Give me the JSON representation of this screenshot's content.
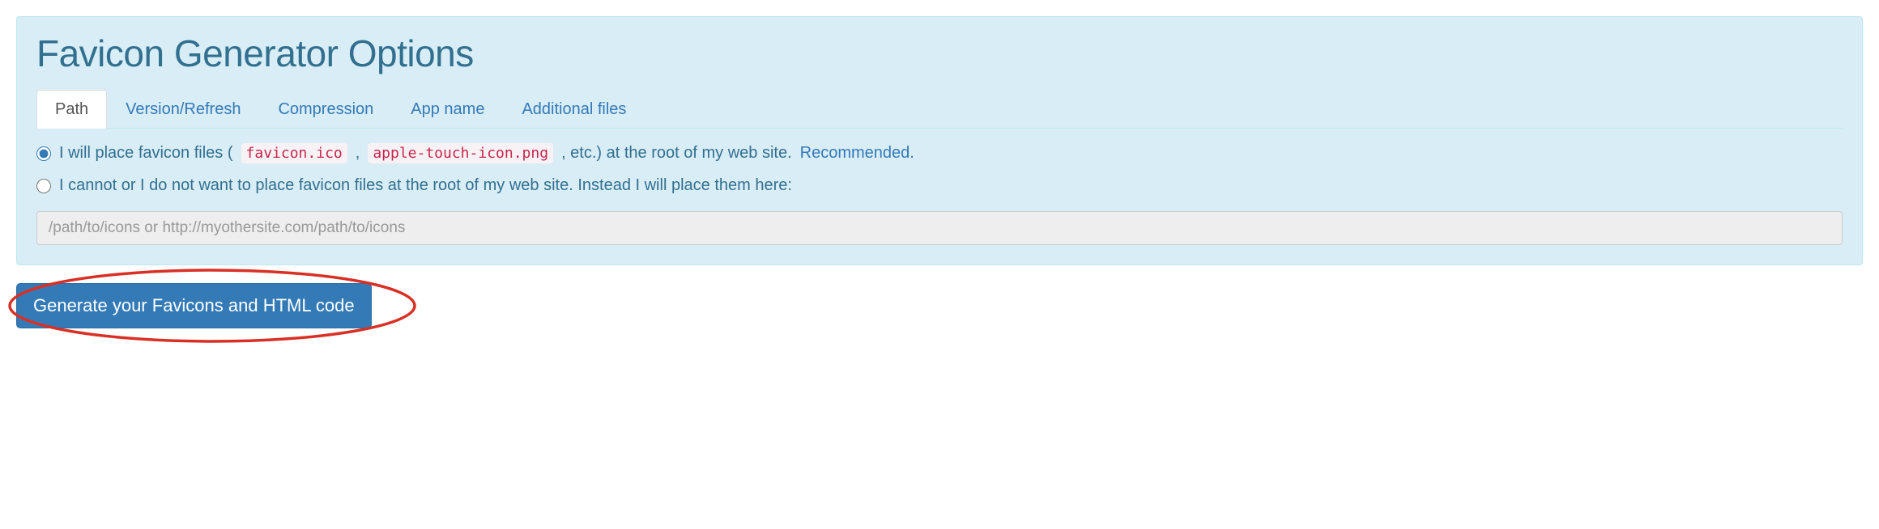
{
  "panel": {
    "title": "Favicon Generator Options"
  },
  "tabs": [
    {
      "label": "Path",
      "active": true
    },
    {
      "label": "Version/Refresh",
      "active": false
    },
    {
      "label": "Compression",
      "active": false
    },
    {
      "label": "App name",
      "active": false
    },
    {
      "label": "Additional files",
      "active": false
    }
  ],
  "option_root": {
    "text_before": "I will place favicon files (",
    "code1": "favicon.ico",
    "sep": ",",
    "code2": "apple-touch-icon.png",
    "text_after": ", etc.) at the root of my web site.",
    "recommended": "Recommended."
  },
  "option_custom": {
    "text": "I cannot or I do not want to place favicon files at the root of my web site. Instead I will place them here:"
  },
  "path_input": {
    "placeholder": "/path/to/icons or http://myothersite.com/path/to/icons",
    "value": ""
  },
  "generate_button": {
    "label": "Generate your Favicons and HTML code"
  }
}
